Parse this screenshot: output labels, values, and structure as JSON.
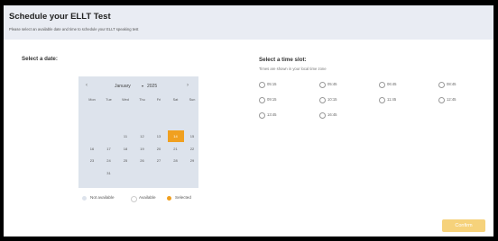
{
  "header": {
    "title": "Schedule your ELLT Test",
    "subtitle": "Please select an available date and time to schedule your ELLT speaking test"
  },
  "date_section": {
    "label": "Select a date:"
  },
  "time_section": {
    "label": "Select a time slot:",
    "timezone_note": "Times are shown in your local time zone"
  },
  "calendar": {
    "prev_icon": "chevron-left-icon",
    "next_icon": "chevron-right-icon",
    "month": "January",
    "year": "2025",
    "weekdays": [
      "Mon",
      "Tue",
      "Wed",
      "Thu",
      "Fri",
      "Sat",
      "Sun"
    ],
    "days": [
      {
        "label": "",
        "status": "disabled"
      },
      {
        "label": "",
        "status": "disabled"
      },
      {
        "label": "",
        "status": "disabled"
      },
      {
        "label": "",
        "status": "disabled"
      },
      {
        "label": "",
        "status": "disabled"
      },
      {
        "label": "",
        "status": "disabled"
      },
      {
        "label": "",
        "status": "disabled"
      },
      {
        "label": "",
        "status": "disabled"
      },
      {
        "label": "",
        "status": "disabled"
      },
      {
        "label": "",
        "status": "disabled"
      },
      {
        "label": "",
        "status": "disabled"
      },
      {
        "label": "",
        "status": "disabled"
      },
      {
        "label": "",
        "status": "disabled"
      },
      {
        "label": "",
        "status": "disabled"
      },
      {
        "label": "",
        "status": "disabled"
      },
      {
        "label": "",
        "status": "disabled"
      },
      {
        "label": "11",
        "status": "available"
      },
      {
        "label": "12",
        "status": "available"
      },
      {
        "label": "13",
        "status": "available"
      },
      {
        "label": "14",
        "status": "selected"
      },
      {
        "label": "15",
        "status": "available"
      },
      {
        "label": "16",
        "status": "available"
      },
      {
        "label": "17",
        "status": "available"
      },
      {
        "label": "18",
        "status": "available"
      },
      {
        "label": "19",
        "status": "available"
      },
      {
        "label": "20",
        "status": "available"
      },
      {
        "label": "21",
        "status": "available"
      },
      {
        "label": "22",
        "status": "available"
      },
      {
        "label": "23",
        "status": "available"
      },
      {
        "label": "24",
        "status": "available"
      },
      {
        "label": "25",
        "status": "available"
      },
      {
        "label": "26",
        "status": "available"
      },
      {
        "label": "27",
        "status": "available"
      },
      {
        "label": "28",
        "status": "available"
      },
      {
        "label": "29",
        "status": "available"
      },
      {
        "label": "",
        "status": "disabled"
      },
      {
        "label": "31",
        "status": "available"
      }
    ]
  },
  "legend": [
    {
      "label": "Not available",
      "color": "#dde3ec"
    },
    {
      "label": "Available",
      "color": "#ffffff"
    },
    {
      "label": "Selected",
      "color": "#f0a020"
    }
  ],
  "time_slots": [
    "05:15",
    "05:45",
    "06:45",
    "08:45",
    "09:15",
    "10:15",
    "11:45",
    "12:45",
    "13:45",
    "16:45"
  ],
  "confirm_button": {
    "label": "Confirm"
  },
  "colors": {
    "accent": "#f0a020",
    "confirm_bg": "#f6d27b",
    "header_bg": "#e9ecf3",
    "calendar_bg": "#dde3ec"
  }
}
